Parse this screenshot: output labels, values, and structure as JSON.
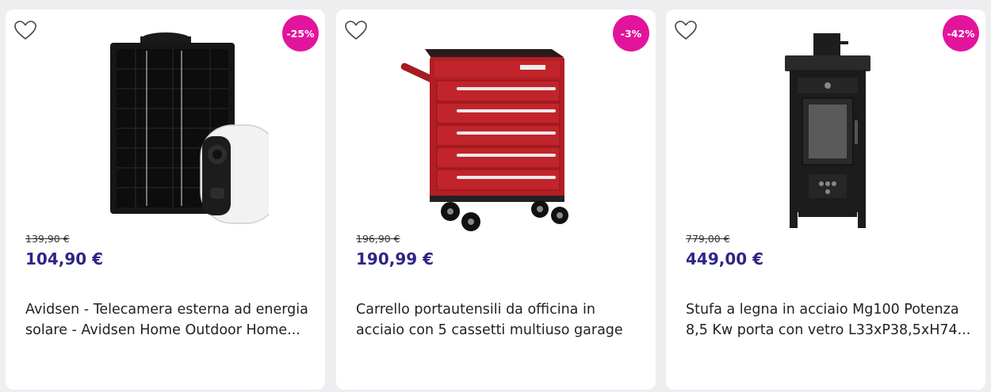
{
  "products": [
    {
      "badge": "-25%",
      "old_price": "139,90 €",
      "price": "104,90 €",
      "title": "Avidsen - Telecamera esterna ad energia solare - Avidsen Home Outdoor Home...",
      "image": "solar-camera-icon"
    },
    {
      "badge": "-3%",
      "old_price": "196,90 €",
      "price": "190,99 €",
      "title": "Carrello portautensili da officina in acciaio con 5 cassetti multiuso garage",
      "image": "tool-cart-icon"
    },
    {
      "badge": "-42%",
      "old_price": "779,00 €",
      "price": "449,00 €",
      "title": "Stufa a legna in acciaio Mg100 Potenza 8,5 Kw porta con vetro L33xP38,5xH74...",
      "image": "wood-stove-icon"
    }
  ],
  "colors": {
    "badge": "#e2149c",
    "price": "#2e2587",
    "background": "#eeeef1"
  }
}
